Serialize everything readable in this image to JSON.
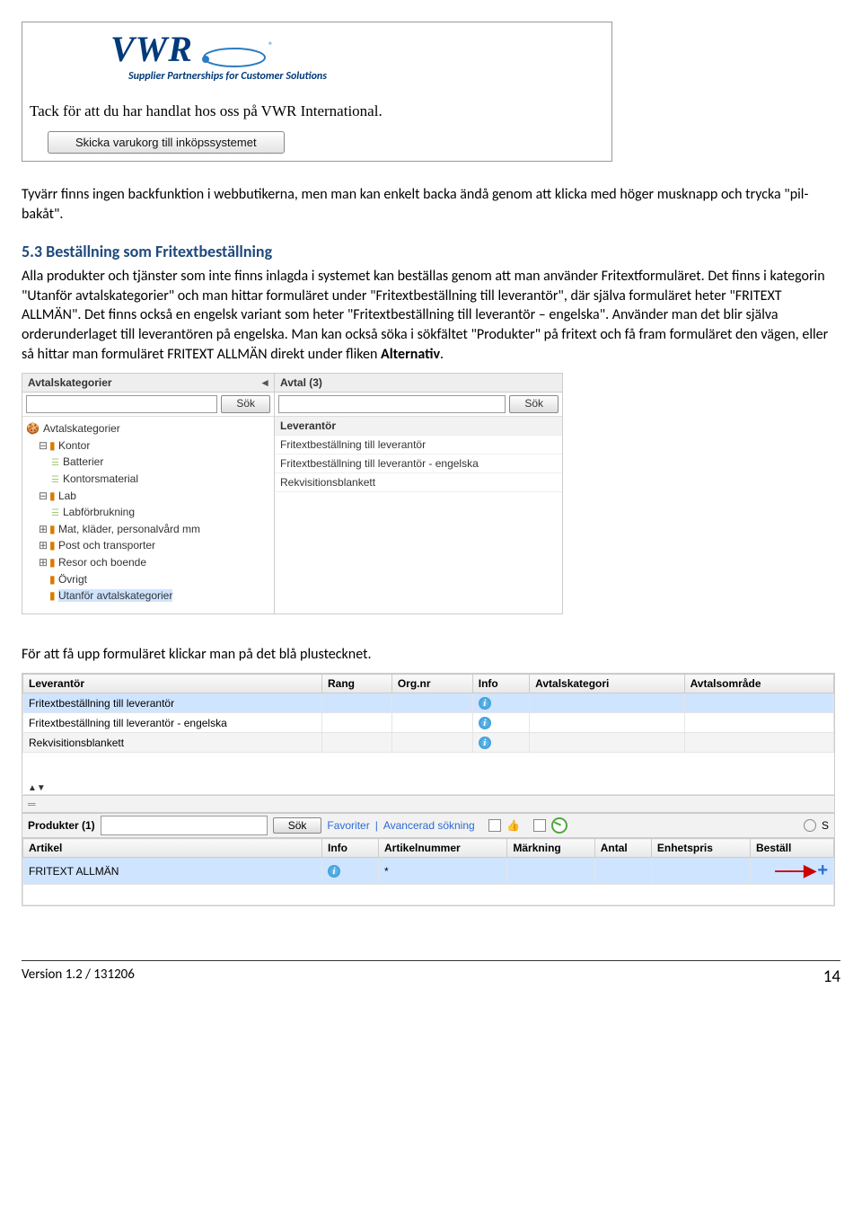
{
  "vwr": {
    "tagline": "Supplier Partnerships for Customer Solutions",
    "message": "Tack för att du har handlat hos oss på VWR International.",
    "button": "Skicka varukorg till inköpssystemet"
  },
  "para1": "Tyvärr finns ingen backfunktion i webbutikerna, men man kan enkelt backa ändå genom att klicka med höger musknapp och trycka \"pil-bakåt\".",
  "section_heading": "5.3 Beställning som Fritextbeställning",
  "para2a": "Alla produkter och tjänster som inte finns inlagda i systemet kan beställas genom att man använder Fritextformuläret. Det finns i kategorin \"Utanför avtalskategorier\" och man hittar formuläret under \"Fritextbeställning till leverantör\", där själva formuläret heter \"FRITEXT ALLMÄN\". Det finns också en engelsk variant som heter \"Fritextbeställning till leverantör – engelska\". Använder man det blir själva orderunderlaget till leverantören på engelska. Man kan också söka i sökfältet \"Produkter\" på fritext och få fram formuläret den vägen, eller så hittar man formuläret FRITEXT ALLMÄN direkt under fliken ",
  "para2b": "Alternativ",
  "para2c": ".",
  "shot2": {
    "cat_header": "Avtalskategorier",
    "avtal_header": "Avtal (3)",
    "sok": "Sök",
    "tree_root": "Avtalskategorier",
    "tree": {
      "kontor": "Kontor",
      "batterier": "Batterier",
      "kontorsmaterial": "Kontorsmaterial",
      "lab": "Lab",
      "labforbrukning": "Labförbrukning",
      "mat": "Mat, kläder, personalvård mm",
      "post": "Post och transporter",
      "resor": "Resor och boende",
      "ovrigt": "Övrigt",
      "utanfor": "Utanför avtalskategorier"
    },
    "lev_header": "Leverantör",
    "lev_rows": [
      "Fritextbeställning till leverantör",
      "Fritextbeställning till leverantör - engelska",
      "Rekvisitionsblankett"
    ]
  },
  "para3": "För att få upp formuläret klickar man på det blå plustecknet.",
  "shot3": {
    "cols1": [
      "Leverantör",
      "Rang",
      "Org.nr",
      "Info",
      "Avtalskategori",
      "Avtalsområde"
    ],
    "rows1": [
      "Fritextbeställning till leverantör",
      "Fritextbeställning till leverantör - engelska",
      "Rekvisitionsblankett"
    ],
    "produkter": "Produkter (1)",
    "sok": "Sök",
    "favoriter": "Favoriter",
    "avancerad": "Avancerad sökning",
    "s_label": "S",
    "cols2": [
      "Artikel",
      "Info",
      "Artikelnummer",
      "Märkning",
      "Antal",
      "Enhetspris",
      "Beställ"
    ],
    "artikel": "FRITEXT ALLMÄN",
    "artnr": "*"
  },
  "footer_left": "Version 1.2 / 131206",
  "footer_right": "14"
}
